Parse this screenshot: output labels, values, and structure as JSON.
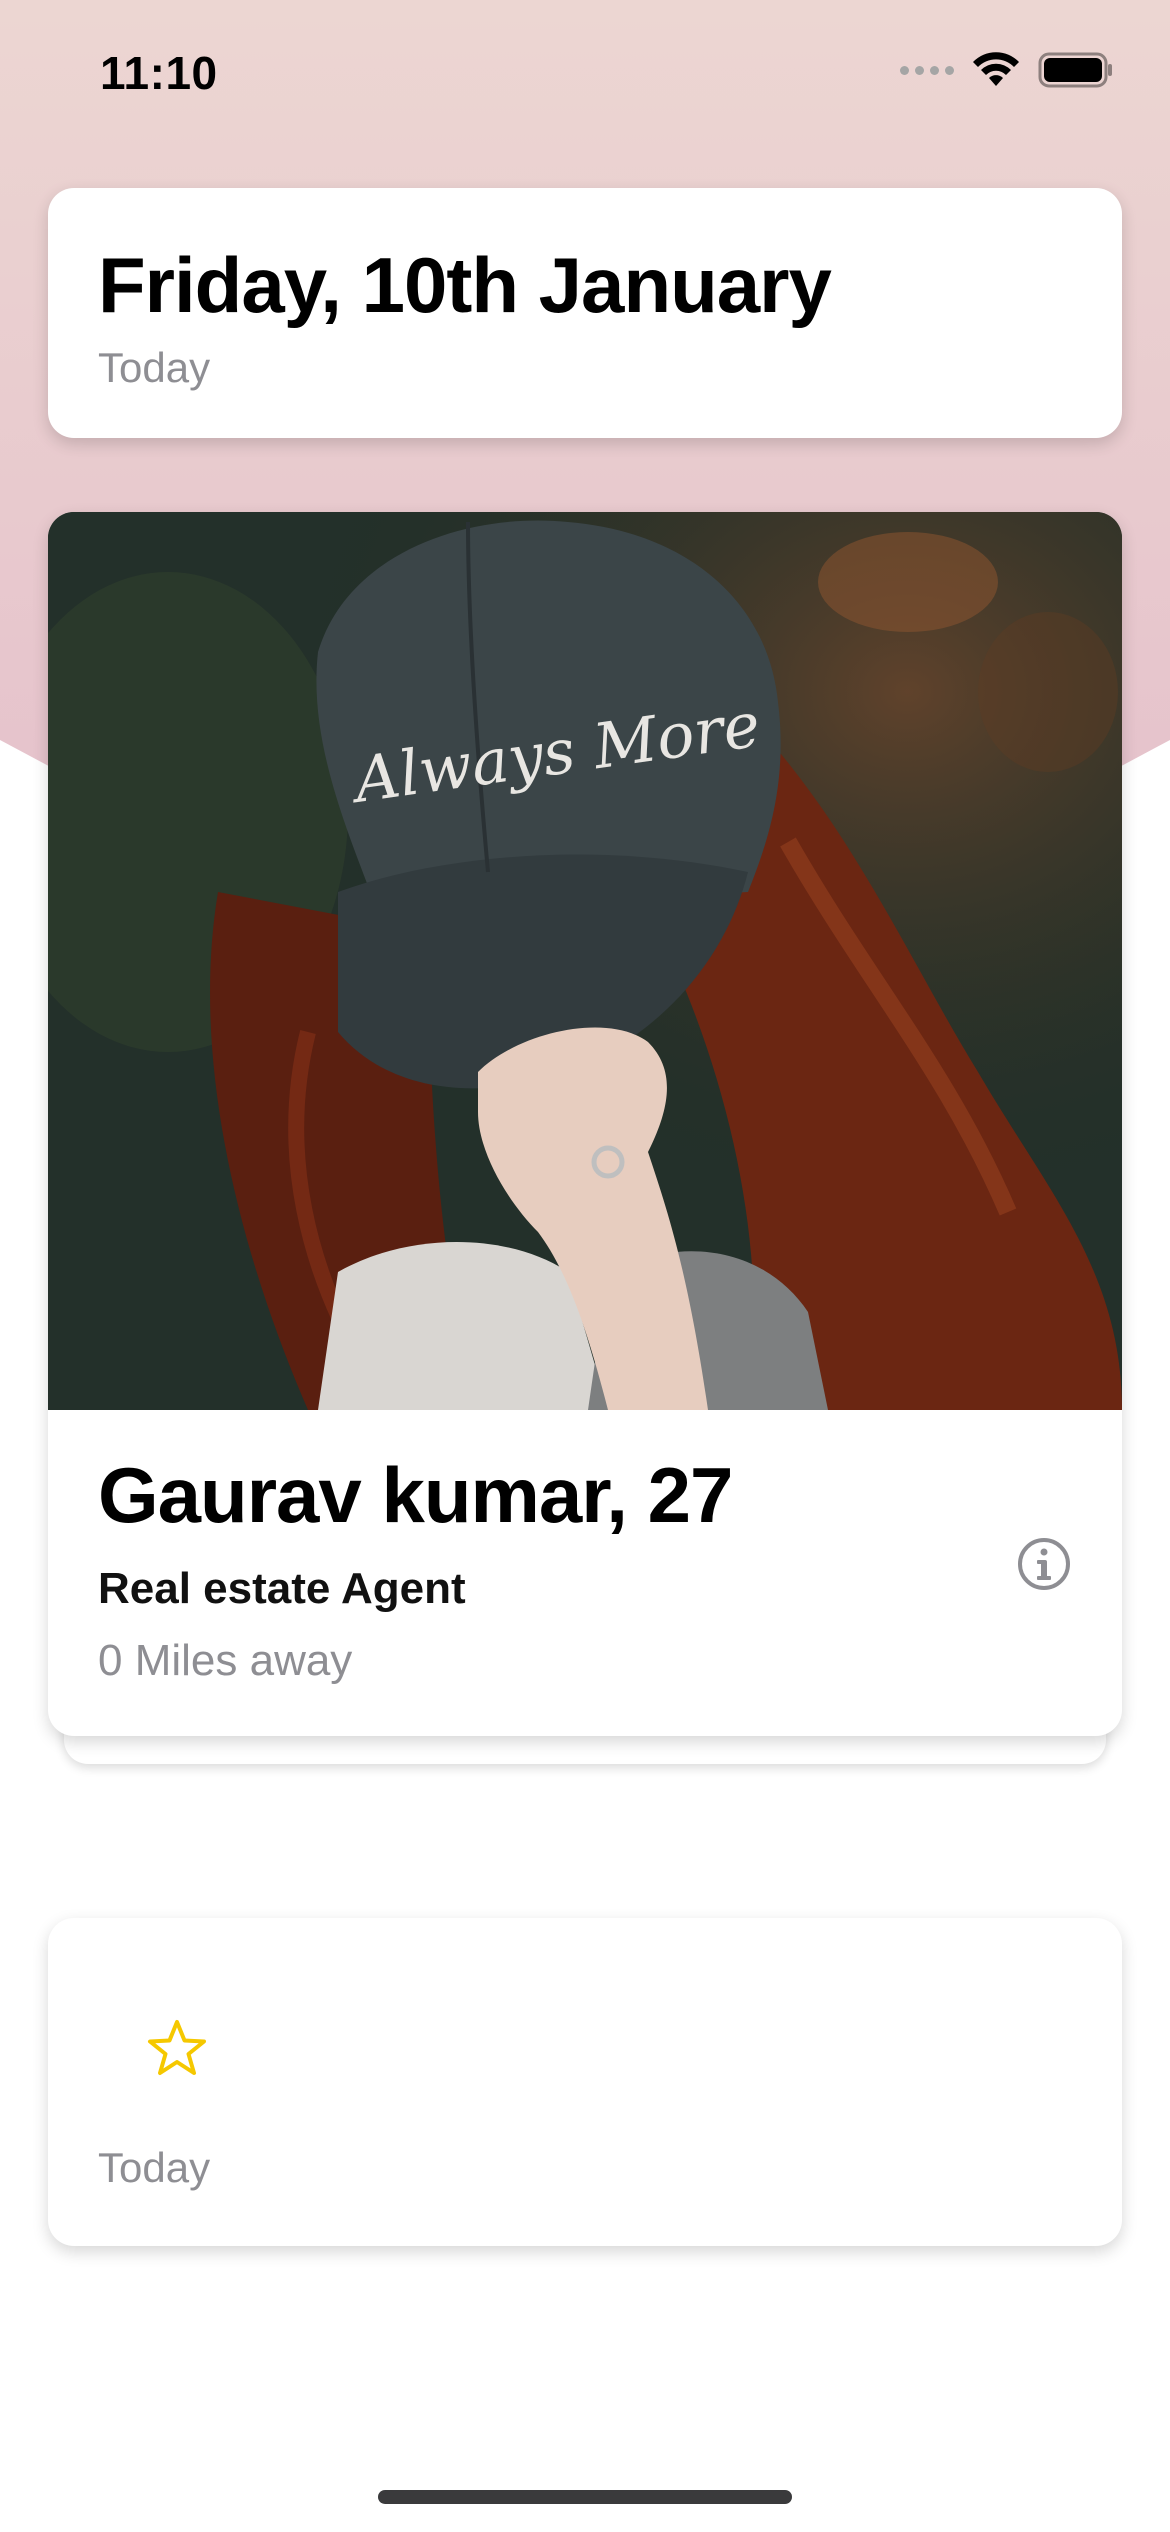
{
  "status_bar": {
    "time": "11:10",
    "icons": [
      "cellular-signal-icon",
      "wifi-icon",
      "battery-icon"
    ]
  },
  "header_card": {
    "date": "Friday, 10th January",
    "subtitle": "Today"
  },
  "profile_card": {
    "photo_caption": "Always More",
    "name": "Gaurav kumar, 27",
    "occupation": "Real estate Agent",
    "distance": "0 Miles away",
    "info_icon": "info-icon"
  },
  "favorites_card": {
    "icon": "star-icon",
    "subtitle": "Today"
  },
  "colors": {
    "header_gradient_top": "#ecd6d2",
    "header_gradient_bottom": "#e6c3cc",
    "secondary_text": "#8e8e93",
    "star": "#f5c800"
  }
}
